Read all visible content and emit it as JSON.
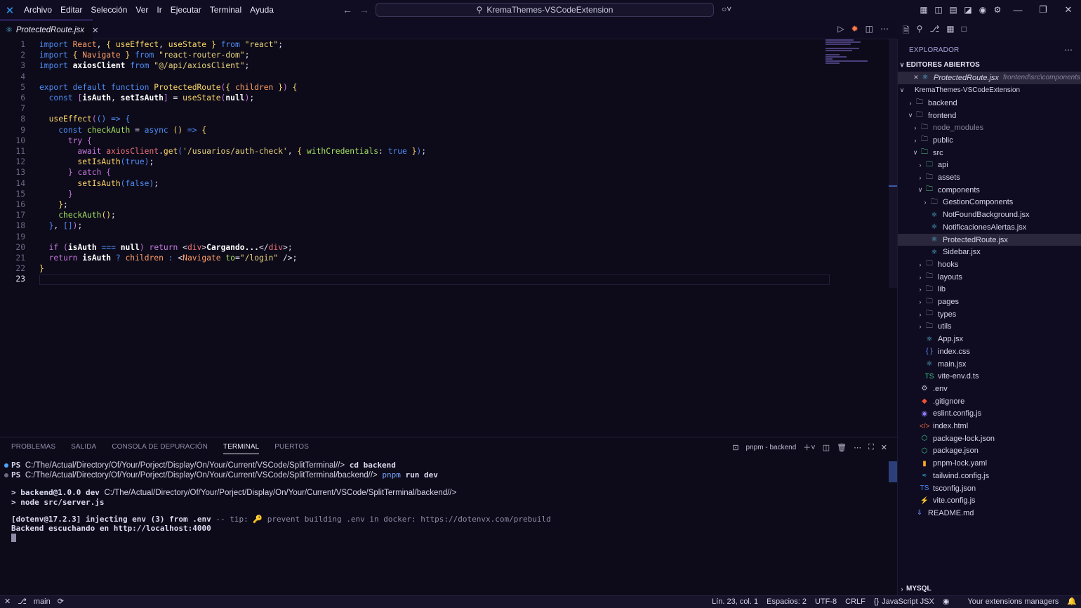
{
  "titlebar": {
    "menu": [
      "Archivo",
      "Editar",
      "Selección",
      "Ver",
      "Ir",
      "Ejecutar",
      "Terminal",
      "Ayuda"
    ],
    "search": "KremaThemes-VSCodeExtension"
  },
  "tab": {
    "label": "ProtectedRoute.jsx"
  },
  "editor": {
    "line_numbers": [
      "1",
      "2",
      "3",
      "4",
      "5",
      "6",
      "7",
      "8",
      "9",
      "10",
      "11",
      "12",
      "13",
      "14",
      "15",
      "16",
      "17",
      "18",
      "19",
      "20",
      "21",
      "22",
      "23"
    ]
  },
  "panel": {
    "tabs": [
      "PROBLEMAS",
      "SALIDA",
      "CONSOLA DE DEPURACIÓN",
      "TERMINAL",
      "PUERTOS"
    ],
    "terminal_name": "pnpm - backend",
    "lines": {
      "l1_ps": "PS",
      "l1_path": "C:/The/Actual/Directory/Of/Your/Porject/Display/On/Your/Current/VSCode/SplitTerminal//>",
      "l1_cmd": "cd backend",
      "l2_ps": "PS",
      "l2_path": "C:/The/Actual/Directory/Of/Your/Porject/Display/On/Your/Current/VSCode/SplitTerminal/backend//>",
      "l2_cmd1": "pnpm",
      "l2_cmd2": "run dev",
      "l3_a": "> backend@1.0.0 dev",
      "l3_path": "C:/The/Actual/Directory/Of/Your/Porject/Display/On/Your/Current/VSCode/SplitTerminal/backend//>",
      "l4": "> node src/server.js",
      "l5_a": "[dotenv@17.2.3] injecting env (3) from .env",
      "l5_b": "-- tip:",
      "l5_c": "prevent building .env in docker: https://dotenvx.com/prebuild",
      "l6": "Backend escuchando en http://localhost:4000"
    }
  },
  "sidebar": {
    "title": "EXPLORADOR",
    "open_editors_header": "EDITORES ABIERTOS",
    "open_file": "ProtectedRoute.jsx",
    "open_file_desc": "frontend\\src\\components",
    "workspace": "KremaThemes-VSCodeExtension",
    "tree": [
      {
        "label": "backend"
      },
      {
        "label": "frontend"
      },
      {
        "label": "node_modules"
      },
      {
        "label": "public"
      },
      {
        "label": "src"
      },
      {
        "label": "api"
      },
      {
        "label": "assets"
      },
      {
        "label": "components"
      },
      {
        "label": "GestionComponents"
      },
      {
        "label": "NotFoundBackground.jsx"
      },
      {
        "label": "NotificacionesAlertas.jsx"
      },
      {
        "label": "ProtectedRoute.jsx"
      },
      {
        "label": "Sidebar.jsx"
      },
      {
        "label": "hooks"
      },
      {
        "label": "layouts"
      },
      {
        "label": "lib"
      },
      {
        "label": "pages"
      },
      {
        "label": "types"
      },
      {
        "label": "utils"
      },
      {
        "label": "App.jsx"
      },
      {
        "label": "index.css"
      },
      {
        "label": "main.jsx"
      },
      {
        "label": "vite-env.d.ts"
      },
      {
        "label": ".env"
      },
      {
        "label": ".gitignore"
      },
      {
        "label": "eslint.config.js"
      },
      {
        "label": "index.html"
      },
      {
        "label": "package-lock.json"
      },
      {
        "label": "package.json"
      },
      {
        "label": "pnpm-lock.yaml"
      },
      {
        "label": "tailwind.config.js"
      },
      {
        "label": "tsconfig.json"
      },
      {
        "label": "vite.config.js"
      },
      {
        "label": "README.md"
      }
    ],
    "mysql": "MYSQL"
  },
  "statusbar": {
    "branch": "main",
    "position": "Lín. 23, col. 1",
    "spaces": "Espacios: 2",
    "encoding": "UTF-8",
    "eol": "CRLF",
    "language": "JavaScript JSX",
    "extensions": "Your extensions managers"
  }
}
